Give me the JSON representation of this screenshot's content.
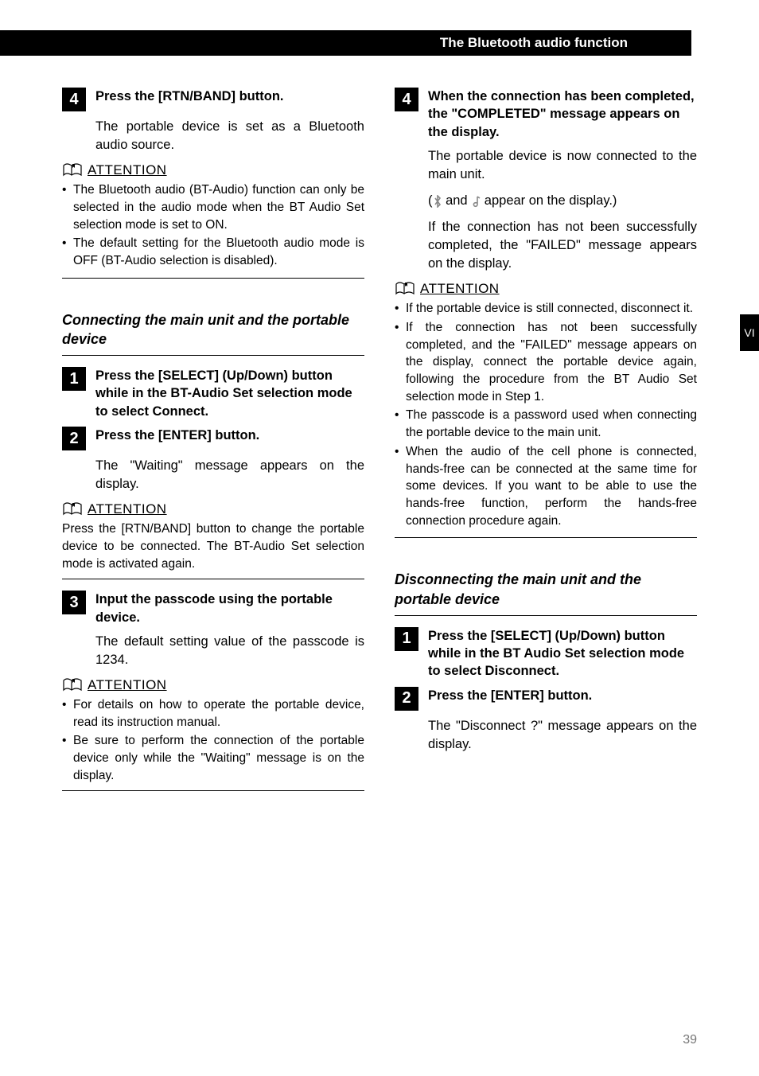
{
  "header": {
    "title": "The Bluetooth audio function"
  },
  "sidebar": {
    "chapter": "VI"
  },
  "pageNumber": "39",
  "left": {
    "step4": {
      "title": "Press the [RTN/BAND] button.",
      "body": "The portable device is set as a Bluetooth audio source."
    },
    "attention1": {
      "label": "ATTENTION",
      "items": [
        "The Bluetooth audio (BT-Audio) function can only be selected in the audio mode when the BT Audio Set selection mode is set to ON.",
        "The default setting for the Bluetooth audio mode is OFF (BT-Audio selection is disabled)."
      ]
    },
    "sectionA": {
      "heading": "Connecting the main unit and the portable device",
      "step1": {
        "title": "Press the [SELECT] (Up/Down) button while in the BT-Audio Set selection mode to select Connect."
      },
      "step2": {
        "title": "Press the [ENTER] button.",
        "body": "The \"Waiting\" message appears on the display."
      },
      "attention2": {
        "label": "ATTENTION",
        "text": "Press the [RTN/BAND] button to change the portable device to be connected. The BT-Audio Set selection mode is activated again."
      },
      "step3": {
        "title": "Input the passcode using the portable device.",
        "body": "The default setting value of the passcode is 1234."
      },
      "attention3": {
        "label": "ATTENTION",
        "items": [
          "For details on how to operate the portable device, read its instruction manual.",
          "Be sure to perform the connection of the portable device only while the \"Waiting\" message is on the display."
        ]
      }
    }
  },
  "right": {
    "step4": {
      "title": "When the connection has been completed, the \"COMPLETED\" message appears on the display.",
      "body1": "The portable device is now connected to the main unit.",
      "body2_pre": "(",
      "body2_mid": " and ",
      "body2_post": " appear on the display.)",
      "body3": "If the connection has not been successfully completed, the \"FAILED\" message appears on the display."
    },
    "attention4": {
      "label": "ATTENTION",
      "items": [
        "If the portable device is still connected, disconnect it.",
        "If the connection has not been successfully completed, and the \"FAILED\" message appears on the display, connect the portable device again, following the procedure from the BT Audio Set selection mode in Step 1.",
        "The passcode is a password used when connecting the portable device to the main unit.",
        "When the audio of the cell phone is connected, hands-free can be connected at the same time for some devices. If you want to be able to use the hands-free function, perform the hands-free connection procedure again."
      ]
    },
    "sectionB": {
      "heading": "Disconnecting the main unit and the portable device",
      "step1": {
        "title": "Press the [SELECT] (Up/Down) button while in the BT Audio Set selection mode to select Disconnect."
      },
      "step2": {
        "title": "Press the [ENTER] button.",
        "body": "The \"Disconnect ?\" message appears on the display."
      }
    }
  }
}
